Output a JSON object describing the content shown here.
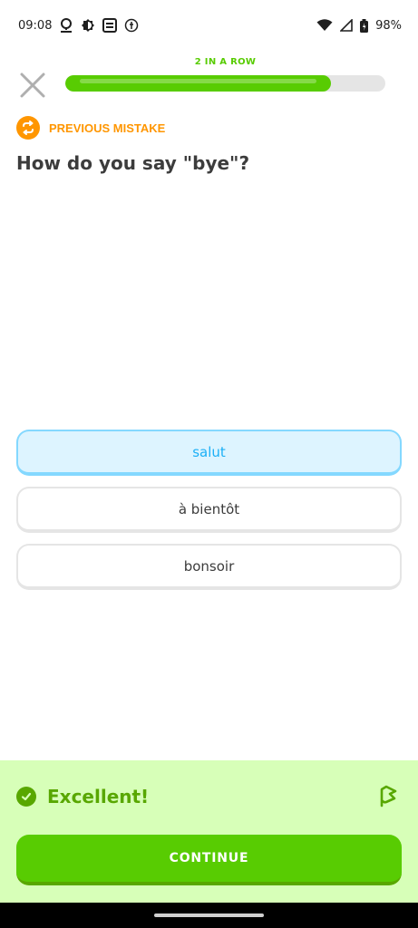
{
  "status_bar": {
    "time": "09:08",
    "battery": "98%",
    "icons": [
      "location-icon",
      "brightness-icon",
      "s-app-icon",
      "accessibility-icon",
      "wifi-icon",
      "cell-signal-icon",
      "battery-icon"
    ]
  },
  "lesson": {
    "streak_label": "2 IN A ROW",
    "progress": 0.83,
    "mistake_label": "PREVIOUS MISTAKE",
    "question": "How do you say \"bye\"?"
  },
  "options": [
    {
      "label": "salut",
      "selected": true
    },
    {
      "label": "à bientôt",
      "selected": false
    },
    {
      "label": "bonsoir",
      "selected": false
    }
  ],
  "feedback": {
    "title": "Excellent!",
    "continue_label": "CONTINUE"
  },
  "colors": {
    "accent_green": "#58cc02",
    "dark_green": "#58a700",
    "feedback_bg": "#d7ffb8",
    "selected_blue": "#1cb0f6",
    "mistake_orange": "#ff9600"
  }
}
